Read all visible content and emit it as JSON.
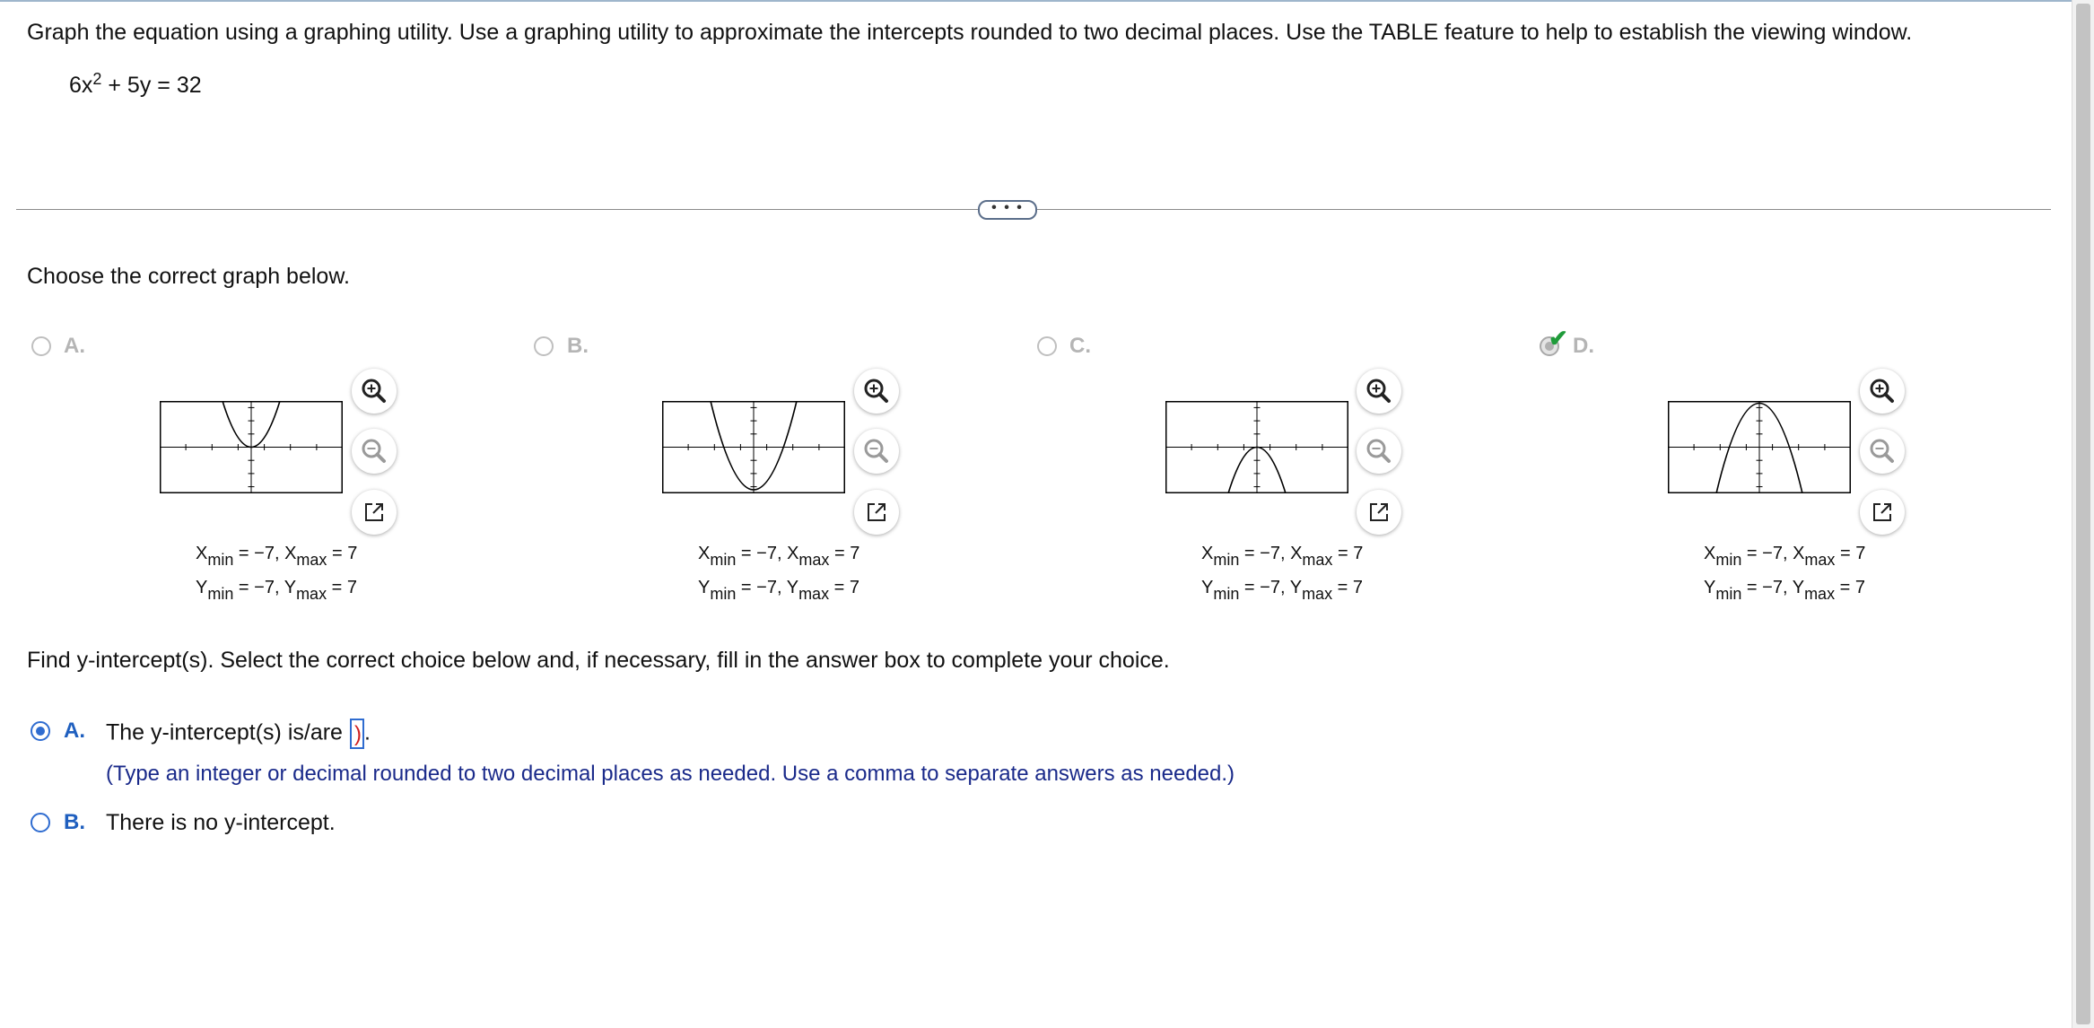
{
  "question": {
    "text": "Graph the equation using a graphing utility. Use a graphing utility to approximate the intercepts rounded to two decimal places. Use the TABLE feature to help to establish the viewing window.",
    "equation": {
      "lhs_coef": "6x",
      "exponent": "2",
      "rest": "+ 5y = 32"
    }
  },
  "expand_button": {
    "label": "• • •"
  },
  "graph_part": {
    "prompt": "Choose the correct graph below.",
    "options": [
      {
        "letter": "A.",
        "shape": "upward-parabola-vertex-at-origin",
        "selected": false,
        "window": {
          "xmin": "−7",
          "xmax": "7",
          "ymin": "−7",
          "ymax": "7"
        }
      },
      {
        "letter": "B.",
        "shape": "upward-parabola-vertex-below",
        "selected": false,
        "window": {
          "xmin": "−7",
          "xmax": "7",
          "ymin": "−7",
          "ymax": "7"
        }
      },
      {
        "letter": "C.",
        "shape": "downward-parabola-vertex-at-origin",
        "selected": false,
        "window": {
          "xmin": "−7",
          "xmax": "7",
          "ymin": "−7",
          "ymax": "7"
        }
      },
      {
        "letter": "D.",
        "shape": "downward-parabola-vertex-above",
        "selected": true,
        "correct_mark": "check-icon",
        "window": {
          "xmin": "−7",
          "xmax": "7",
          "ymin": "−7",
          "ymax": "7"
        }
      }
    ],
    "tool_icons": [
      "zoom-in-icon",
      "zoom-out-icon",
      "open-new-window-icon"
    ]
  },
  "intercept_part": {
    "prompt": "Find y-intercept(s). Select the correct choice below and, if necessary, fill in the answer box to complete your choice.",
    "choices": [
      {
        "letter": "A.",
        "text": "The y-intercept(s) is/are",
        "answer_value": "",
        "suffix": ".",
        "selected": true,
        "hint": "(Type an integer or decimal rounded to two decimal places as needed. Use a comma to separate answers as needed.)"
      },
      {
        "letter": "B.",
        "text": "There is no y-intercept.",
        "selected": false
      }
    ]
  },
  "colors": {
    "accent": "#2f6cd0",
    "check": "#1f9b3a",
    "hint": "#1a2a8a",
    "cursor": "#d02020"
  }
}
